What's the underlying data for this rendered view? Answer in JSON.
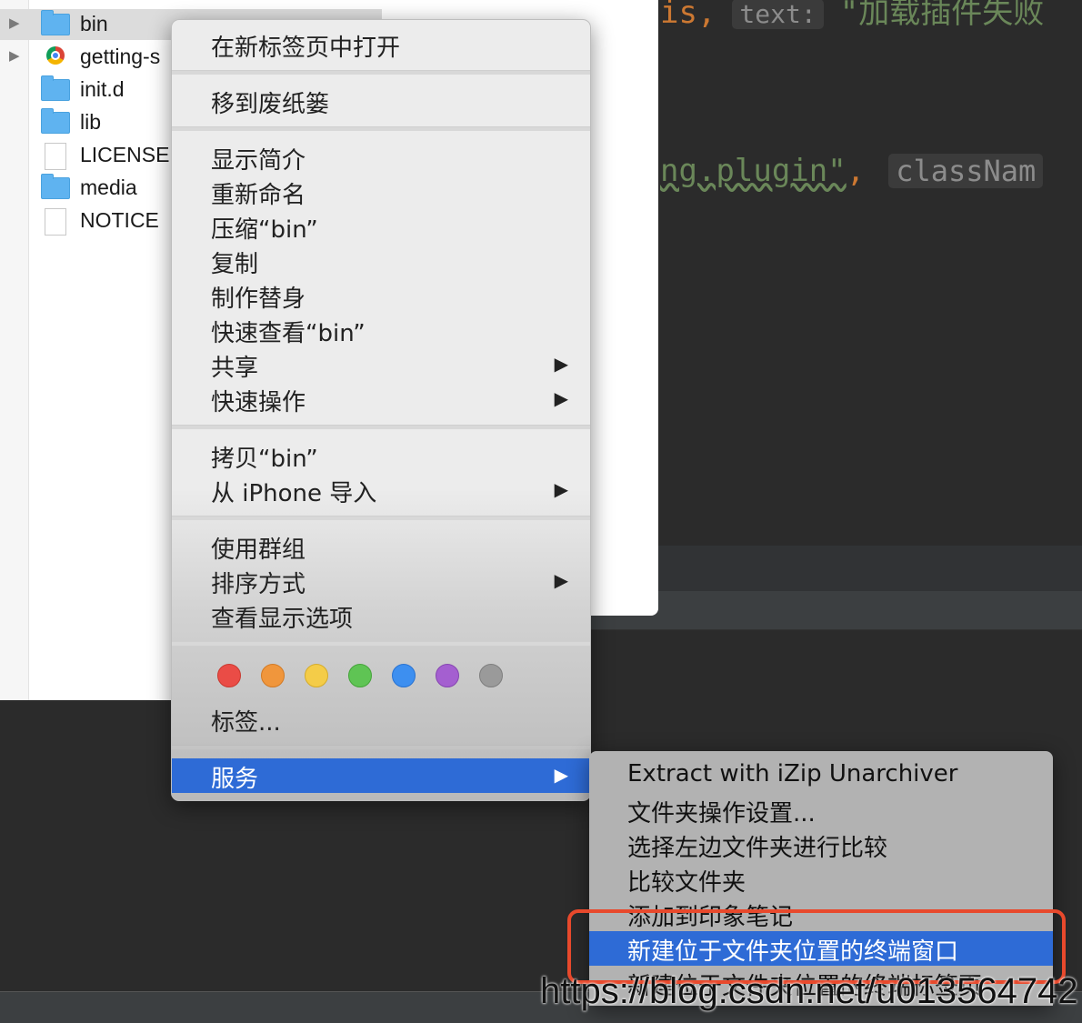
{
  "editor": {
    "line1_prefix": "is,",
    "line1_hint": "text:",
    "line1_string": "\"加载插件失败",
    "line2_code": "ng.plugin\"",
    "line2_comma": ",",
    "line2_hint": "classNam"
  },
  "finder": {
    "rows": [
      {
        "name": "bin",
        "icon": "folder-icon"
      },
      {
        "name": "getting-s",
        "icon": "chrome-icon"
      },
      {
        "name": "init.d",
        "icon": "folder-icon"
      },
      {
        "name": "lib",
        "icon": "folder-icon"
      },
      {
        "name": "LICENSE",
        "icon": "document-icon"
      },
      {
        "name": "media",
        "icon": "folder-icon"
      },
      {
        "name": "NOTICE",
        "icon": "document-icon"
      }
    ]
  },
  "context_menu": {
    "open_new_tab": "在新标签页中打开",
    "move_to_trash": "移到废纸篓",
    "get_info": "显示简介",
    "rename": "重新命名",
    "compress": "压缩“bin”",
    "duplicate": "复制",
    "make_alias": "制作替身",
    "quick_look": "快速查看“bin”",
    "share": "共享",
    "quick_actions": "快速操作",
    "copy": "拷贝“bin”",
    "import_iphone": "从 iPhone 导入",
    "use_groups": "使用群组",
    "sort_by": "排序方式",
    "view_options": "查看显示选项",
    "tags": "标签...",
    "services": "服务",
    "submenu_arrow": "▶",
    "tag_colors": [
      "#ea4c46",
      "#f0963c",
      "#f4cc48",
      "#5fc454",
      "#3d8ff0",
      "#a45fd0",
      "#9a9a9a"
    ]
  },
  "services_menu": {
    "items": [
      "Extract with iZip Unarchiver",
      "文件夹操作设置...",
      "选择左边文件夹进行比较",
      "比较文件夹",
      "添加到印象笔记",
      "新建位于文件夹位置的终端窗口",
      "新建位于文件夹位置的终端标签页"
    ],
    "highlighted_index": 5
  },
  "watermark": "https://blog.csdn.net/u013564742"
}
